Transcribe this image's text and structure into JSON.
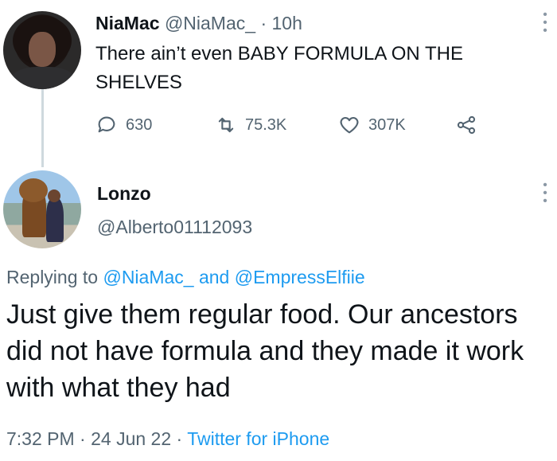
{
  "tweet1": {
    "display_name": "NiaMac",
    "handle": "@NiaMac_",
    "separator": "·",
    "time": "10h",
    "text": "There ain’t even BABY FORMULA ON THE SHELVES",
    "actions": {
      "replies": "630",
      "retweets": "75.3K",
      "likes": "307K"
    },
    "icons": [
      "reply-icon",
      "retweet-icon",
      "like-icon",
      "share-icon",
      "more-icon"
    ]
  },
  "tweet2": {
    "display_name": "Lonzo",
    "handle": "@Alberto01112093",
    "replying_prefix": "Replying to",
    "replying_user1": "@NiaMac_",
    "replying_and": "and",
    "replying_user2": "@EmpressElfiie",
    "text": "Just give them regular food. Our ancestors did not have formula and they made it work with what they had",
    "time": "7:32 PM",
    "sep1": "·",
    "date": "24 Jun 22",
    "sep2": "·",
    "source": "Twitter for iPhone"
  },
  "colors": {
    "text": "#0f1419",
    "secondary": "#536471",
    "link": "#1d9bf0",
    "thread_line": "#cfd9de"
  }
}
